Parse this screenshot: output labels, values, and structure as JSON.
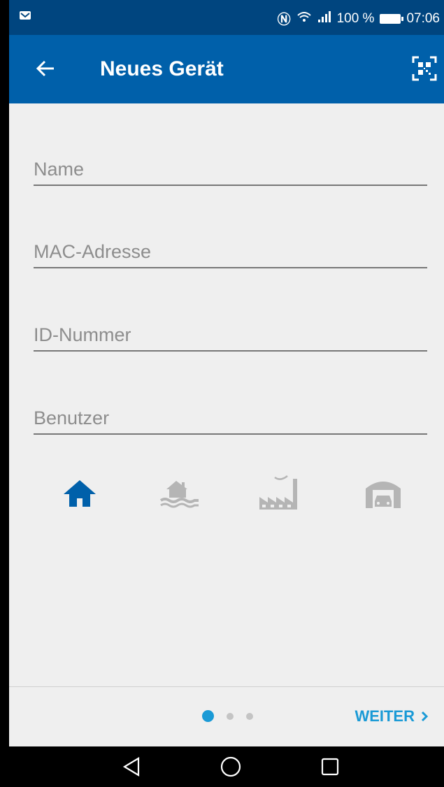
{
  "status_bar": {
    "time": "07:06",
    "battery": "100 %",
    "icons": [
      "mail-icon",
      "nfc-icon",
      "wifi-icon",
      "signal-icon",
      "battery-icon"
    ]
  },
  "app_bar": {
    "title": "Neues Gerät",
    "back_icon": "arrow-left-icon",
    "action_icon": "qr-code-icon"
  },
  "form": {
    "name": {
      "placeholder": "Name",
      "value": ""
    },
    "mac": {
      "placeholder": "MAC-Adresse",
      "value": ""
    },
    "id": {
      "placeholder": "ID-Nummer",
      "value": ""
    },
    "user": {
      "placeholder": "Benutzer",
      "value": ""
    }
  },
  "device_types": [
    {
      "icon": "house-icon",
      "selected": true
    },
    {
      "icon": "flooded-house-icon",
      "selected": false
    },
    {
      "icon": "factory-icon",
      "selected": false
    },
    {
      "icon": "garage-car-icon",
      "selected": false
    }
  ],
  "colors": {
    "status_bar": "#00457f",
    "app_bar": "#0060aa",
    "accent": "#1a9ad6",
    "selected_icon": "#0060aa",
    "unselected_icon": "#b5b5b5"
  },
  "pager": {
    "current": 1,
    "total": 3
  },
  "footer": {
    "next_label": "WEITER"
  },
  "nav_bar": {
    "icons": [
      "back-triangle-icon",
      "home-circle-icon",
      "recents-square-icon"
    ]
  }
}
